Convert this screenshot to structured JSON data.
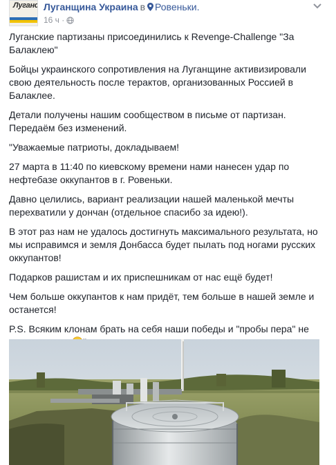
{
  "post": {
    "page_name": "Луганщина Украина",
    "in_word": "в",
    "location": "Ровеньки.",
    "time": "16 ч",
    "avatar_text": "Луганск",
    "paragraphs": [
      "Луганские партизаны присоединились к Revenge-Challenge \"За Балаклею\"",
      "Бойцы украинского сопротивления на Луганщине активизировали свою деятельность после терактов, организованных Россией в Балаклее.",
      "Детали получены нашим сообществом в письме от партизан. Передаём без изменений.",
      "\"Уважаемые патриоты, докладываем!",
      "27 марта в 11:40 по киевскому времени нами нанесен удар по нефтебазе оккупантов в г. Ровеньки.",
      "Давно целились, вариант реализации нашей маленькой мечты перехватили у дончан (отдельное спасибо за идею!).",
      "В этот раз нам не удалось достигнуть максимального результата, но мы исправимся и земля Донбасса будет пылать под ногами русских оккупантов!",
      "Подарков рашистам и их приспешникам от нас ещё будет!",
      "Чем больше оккупантов к нам придёт, тем больше в нашей земле и останется!"
    ],
    "last_paragraph_text": "P.S. Всяким клонам брать на себя наши победы и \"пробы пера\" не рекомендуем",
    "last_paragraph_end": "\""
  },
  "icons": {
    "location": "map-pin-icon",
    "audience": "globe-icon",
    "menu": "chevron-down-icon",
    "emoji": "smiley-face-icon"
  },
  "colors": {
    "link": "#365899",
    "text": "#1d2129",
    "meta": "#90949c",
    "background": "#ffffff"
  }
}
